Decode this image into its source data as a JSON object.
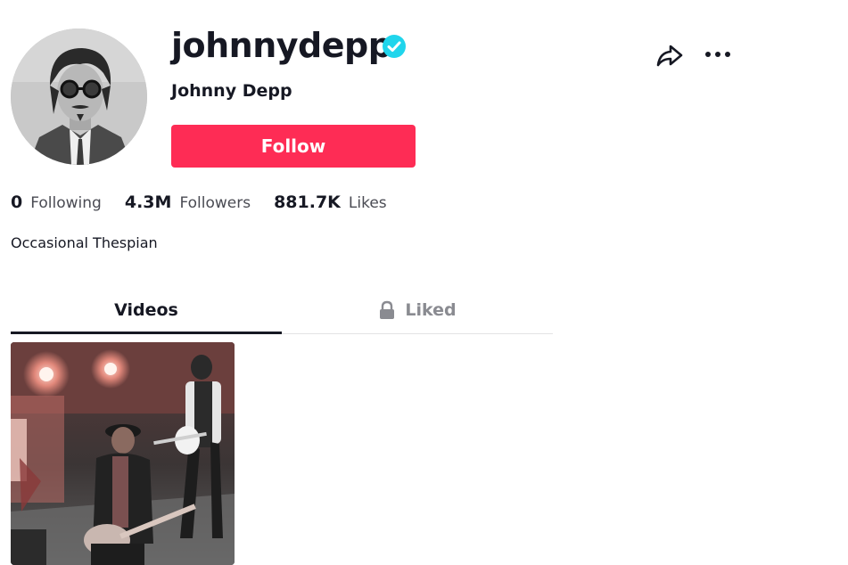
{
  "profile": {
    "username": "johnnydepp",
    "display_name": "Johnny Depp",
    "verified": true,
    "follow_label": "Follow",
    "bio": "Occasional Thespian"
  },
  "stats": [
    {
      "value": "0",
      "label": "Following"
    },
    {
      "value": "4.3M",
      "label": "Followers"
    },
    {
      "value": "881.7K",
      "label": "Likes"
    }
  ],
  "tabs": [
    {
      "label": "Videos",
      "active": true,
      "locked": false
    },
    {
      "label": "Liked",
      "active": false,
      "locked": true
    }
  ],
  "icons": {
    "share": "share-arrow-icon",
    "more": "more-horizontal-icon",
    "verified": "verified-check-icon",
    "lock": "lock-icon"
  },
  "colors": {
    "follow_button": "#fe2c55",
    "verified_badge": "#20d5ec",
    "text_primary": "#161823",
    "text_secondary": "#4a4b53",
    "tab_inactive": "#8a8b91"
  }
}
